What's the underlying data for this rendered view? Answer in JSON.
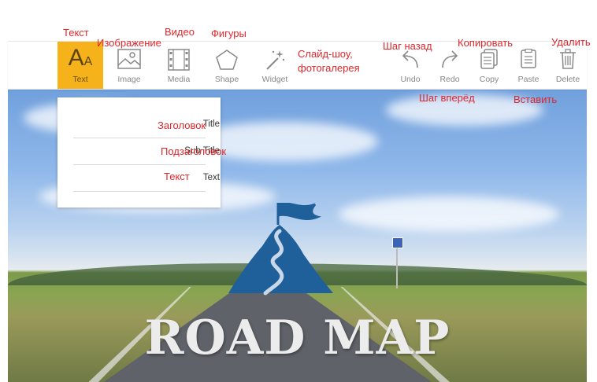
{
  "toolbar": {
    "items": [
      {
        "label": "Text",
        "icon": "text-aa-icon",
        "active": true
      },
      {
        "label": "Image",
        "icon": "image-icon"
      },
      {
        "label": "Media",
        "icon": "film-strip-icon"
      },
      {
        "label": "Shape",
        "icon": "pentagon-icon"
      },
      {
        "label": "Widget",
        "icon": "magic-wand-icon"
      },
      {
        "label": "Undo",
        "icon": "undo-arrow-icon"
      },
      {
        "label": "Redo",
        "icon": "redo-arrow-icon"
      },
      {
        "label": "Copy",
        "icon": "copy-icon"
      },
      {
        "label": "Paste",
        "icon": "paste-icon"
      },
      {
        "label": "Delete",
        "icon": "trash-icon"
      }
    ],
    "text_icon_big": "A",
    "text_icon_small": "A",
    "active_color": "#f5b21a"
  },
  "text_menu": {
    "items": [
      {
        "label": "Title"
      },
      {
        "label": "Sub Title"
      },
      {
        "label": "Text"
      }
    ]
  },
  "canvas": {
    "headline": "ROAD MAP",
    "logo_color": "#1f5f9a"
  },
  "annotations": {
    "text": "Текст",
    "image": "Изображение",
    "video": "Видео",
    "shapes": "Фигуры",
    "widget_line1": "Слайд-шоу,",
    "widget_line2": "фотогалерея",
    "undo": "Шаг назад",
    "redo": "Шаг вперёд",
    "copy": "Копировать",
    "paste": "Вставить",
    "delete": "Удалить",
    "title": "Заголовок",
    "subtitle": "Подзаголовок",
    "body": "Текст",
    "color": "#e0262b"
  }
}
